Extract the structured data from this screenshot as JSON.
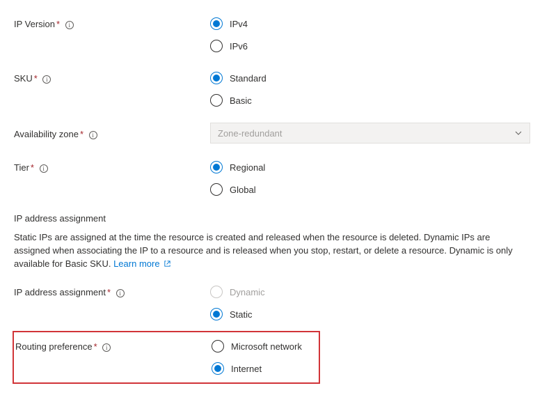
{
  "ipVersion": {
    "label": "IP Version",
    "options": {
      "ipv4": "IPv4",
      "ipv6": "IPv6"
    }
  },
  "sku": {
    "label": "SKU",
    "options": {
      "standard": "Standard",
      "basic": "Basic"
    }
  },
  "availabilityZone": {
    "label": "Availability zone",
    "value": "Zone-redundant"
  },
  "tier": {
    "label": "Tier",
    "options": {
      "regional": "Regional",
      "global": "Global"
    }
  },
  "assignmentSection": {
    "title": "IP address assignment",
    "help": "Static IPs are assigned at the time the resource is created and released when the resource is deleted. Dynamic IPs are assigned when associating the IP to a resource and is released when you stop, restart, or delete a resource. Dynamic is only available for Basic SKU.",
    "learnMore": "Learn more"
  },
  "assignment": {
    "label": "IP address assignment",
    "options": {
      "dynamic": "Dynamic",
      "static": "Static"
    }
  },
  "routing": {
    "label": "Routing preference",
    "options": {
      "ms": "Microsoft network",
      "internet": "Internet"
    }
  }
}
